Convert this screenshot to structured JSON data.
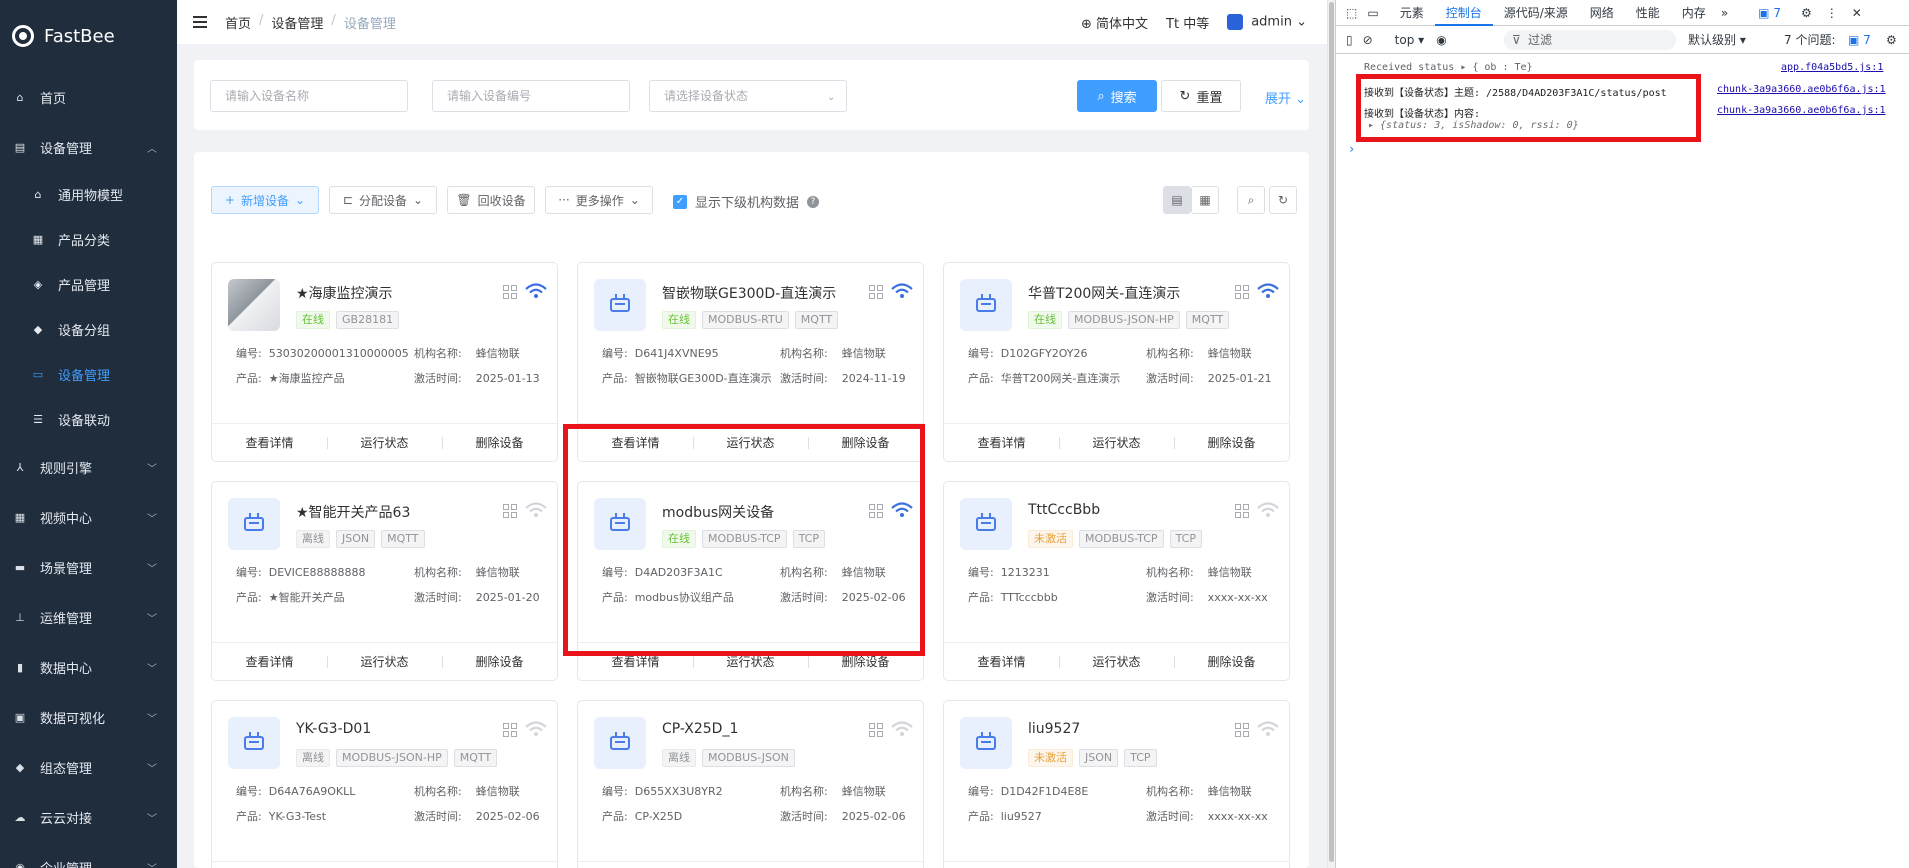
{
  "app": {
    "name": "FastBee"
  },
  "sidebar": {
    "items": [
      {
        "label": "首页",
        "icon": "home-icon"
      },
      {
        "label": "设备管理",
        "icon": "device-icon",
        "expanded": true
      },
      {
        "label": "规则引擎",
        "icon": "rule-icon"
      },
      {
        "label": "视频中心",
        "icon": "video-icon"
      },
      {
        "label": "场景管理",
        "icon": "scene-icon"
      },
      {
        "label": "运维管理",
        "icon": "ops-icon"
      },
      {
        "label": "数据中心",
        "icon": "data-icon"
      },
      {
        "label": "数据可视化",
        "icon": "chart-icon"
      },
      {
        "label": "组态管理",
        "icon": "config-icon"
      },
      {
        "label": "云云对接",
        "icon": "cloud-icon"
      },
      {
        "label": "企业管理",
        "icon": "enterprise-icon"
      }
    ],
    "subitems": [
      {
        "label": "通用物模型"
      },
      {
        "label": "产品分类"
      },
      {
        "label": "产品管理"
      },
      {
        "label": "设备分组"
      },
      {
        "label": "设备管理",
        "active": true
      },
      {
        "label": "设备联动"
      }
    ]
  },
  "header": {
    "breadcrumbs": [
      "首页",
      "设备管理",
      "设备管理"
    ],
    "language": "简体中文",
    "font_size": "中等",
    "user": "admin"
  },
  "search": {
    "name_placeholder": "请输入设备名称",
    "serial_placeholder": "请输入设备编号",
    "status_placeholder": "请选择设备状态",
    "search_label": "搜索",
    "reset_label": "重置",
    "expand_label": "展开"
  },
  "toolbar": {
    "add_label": "新增设备",
    "assign_label": "分配设备",
    "recycle_label": "回收设备",
    "more_label": "更多操作",
    "show_sub_label": "显示下级机构数据",
    "show_sub_checked": true
  },
  "labels": {
    "serial": "编号:",
    "org": "机构名称:",
    "product": "产品:",
    "activated": "激活时间:",
    "view": "查看详情",
    "run_status": "运行状态",
    "delete": "删除设备"
  },
  "devices": [
    {
      "name": "★海康监控演示",
      "status": "在线",
      "status_type": "online",
      "tags": [
        "GB28181"
      ],
      "serial": "53030200001310000005",
      "org": "蜂信物联",
      "product": "★海康监控产品",
      "activated": "2025-01-13",
      "wifi": true,
      "photo": true
    },
    {
      "name": "智嵌物联GE300D-直连演示",
      "status": "在线",
      "status_type": "online",
      "tags": [
        "MODBUS-RTU",
        "MQTT"
      ],
      "serial": "D641J4XVNE95",
      "org": "蜂信物联",
      "product": "智嵌物联GE300D-直连演示",
      "activated": "2024-11-19",
      "wifi": true
    },
    {
      "name": "华普T200网关-直连演示",
      "status": "在线",
      "status_type": "online",
      "tags": [
        "MODBUS-JSON-HP",
        "MQTT"
      ],
      "serial": "D102GFY2OY26",
      "org": "蜂信物联",
      "product": "华普T200网关-直连演示",
      "activated": "2025-01-21",
      "wifi": true
    },
    {
      "name": "★智能开关产品63",
      "status": "离线",
      "status_type": "offline",
      "tags": [
        "JSON",
        "MQTT"
      ],
      "serial": "DEVICE88888888",
      "org": "蜂信物联",
      "product": "★智能开关产品",
      "activated": "2025-01-20",
      "wifi": false
    },
    {
      "name": "modbus网关设备",
      "status": "在线",
      "status_type": "online",
      "tags": [
        "MODBUS-TCP",
        "TCP"
      ],
      "serial": "D4AD203F3A1C",
      "org": "蜂信物联",
      "product": "modbus协议组产品",
      "activated": "2025-02-06",
      "wifi": true
    },
    {
      "name": "TttCccBbb",
      "status": "未激活",
      "status_type": "inactive",
      "tags": [
        "MODBUS-TCP",
        "TCP"
      ],
      "serial": "1213231",
      "org": "蜂信物联",
      "product": "TTTcccbbb",
      "activated": "xxxx-xx-xx",
      "wifi": false
    },
    {
      "name": "YK-G3-D01",
      "status": "离线",
      "status_type": "offline",
      "tags": [
        "MODBUS-JSON-HP",
        "MQTT"
      ],
      "serial": "D64A76A9OKLL",
      "org": "蜂信物联",
      "product": "YK-G3-Test",
      "activated": "2025-02-06",
      "wifi": false
    },
    {
      "name": "CP-X25D_1",
      "status": "离线",
      "status_type": "offline",
      "tags": [
        "MODBUS-JSON"
      ],
      "serial": "D655XX3U8YR2",
      "org": "蜂信物联",
      "product": "CP-X25D",
      "activated": "2025-02-06",
      "wifi": false
    },
    {
      "name": "liu9527",
      "status": "未激活",
      "status_type": "inactive",
      "tags": [
        "JSON",
        "TCP"
      ],
      "serial": "D1D42F1D4E8E",
      "org": "蜂信物联",
      "product": "liu9527",
      "activated": "xxxx-xx-xx",
      "wifi": false
    }
  ],
  "devtools": {
    "tabs": [
      "元素",
      "控制台",
      "源代码/来源",
      "网络",
      "性能",
      "内存"
    ],
    "active_tab": "控制台",
    "message_count": "7",
    "context": "top",
    "filter_placeholder": "过滤",
    "level": "默认级别",
    "issues": "7 个问题:",
    "issues_count": "7",
    "console": [
      {
        "text": "Received status ▸ { ob : Te}",
        "source": "app.f04a5bd5.js:1"
      },
      {
        "text": "接收到【设备状态】主题: /2588/D4AD203F3A1C/status/post",
        "source": "chunk-3a9a3660.ae0b6f6a.js:1"
      },
      {
        "text": "接收到【设备状态】内容:",
        "source": "chunk-3a9a3660.ae0b6f6a.js:1"
      },
      {
        "text": "▸ {status: 3, isShadow: 0, rssi: 0}",
        "source": ""
      }
    ],
    "prompt": "›"
  },
  "colors": {
    "sidebar_bg": "#1f2d3d",
    "accent": "#409eff",
    "highlight": "#e8141a"
  }
}
